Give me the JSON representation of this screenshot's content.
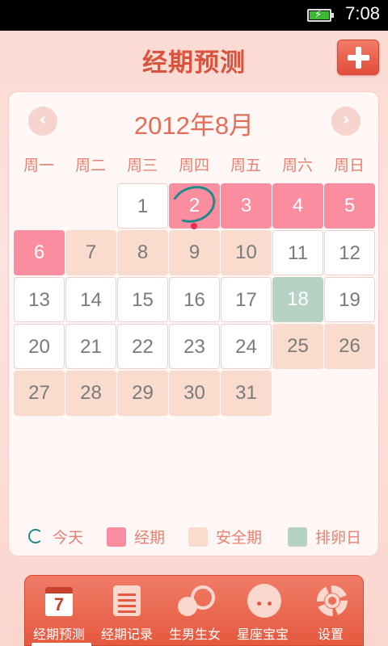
{
  "status_bar": {
    "time": "7:08",
    "battery_icon": "battery-charging-icon"
  },
  "header": {
    "title": "经期预测",
    "add_icon": "plus-icon"
  },
  "calendar": {
    "month_label": "2012年8月",
    "prev_icon": "chevron-left-icon",
    "next_icon": "chevron-right-icon",
    "weekdays": [
      "周一",
      "周二",
      "周三",
      "周四",
      "周五",
      "周六",
      "周日"
    ],
    "today": "2",
    "days": [
      {
        "label": "1",
        "type": "normal"
      },
      {
        "label": "2",
        "type": "period"
      },
      {
        "label": "3",
        "type": "period"
      },
      {
        "label": "4",
        "type": "period"
      },
      {
        "label": "5",
        "type": "period"
      },
      {
        "label": "6",
        "type": "period"
      },
      {
        "label": "7",
        "type": "safe"
      },
      {
        "label": "8",
        "type": "safe"
      },
      {
        "label": "9",
        "type": "safe"
      },
      {
        "label": "10",
        "type": "safe"
      },
      {
        "label": "11",
        "type": "normal"
      },
      {
        "label": "12",
        "type": "normal"
      },
      {
        "label": "13",
        "type": "normal"
      },
      {
        "label": "14",
        "type": "normal"
      },
      {
        "label": "15",
        "type": "normal"
      },
      {
        "label": "16",
        "type": "normal"
      },
      {
        "label": "17",
        "type": "normal"
      },
      {
        "label": "18",
        "type": "ovulation"
      },
      {
        "label": "19",
        "type": "normal"
      },
      {
        "label": "20",
        "type": "normal"
      },
      {
        "label": "21",
        "type": "normal"
      },
      {
        "label": "22",
        "type": "normal"
      },
      {
        "label": "23",
        "type": "normal"
      },
      {
        "label": "24",
        "type": "normal"
      },
      {
        "label": "25",
        "type": "safe"
      },
      {
        "label": "26",
        "type": "safe"
      },
      {
        "label": "27",
        "type": "safe"
      },
      {
        "label": "28",
        "type": "safe"
      },
      {
        "label": "29",
        "type": "safe"
      },
      {
        "label": "30",
        "type": "safe"
      },
      {
        "label": "31",
        "type": "safe"
      }
    ]
  },
  "legend": {
    "today": "今天",
    "period": "经期",
    "safe": "安全期",
    "ovulation": "排卵日"
  },
  "colors": {
    "period": "#fb8da0",
    "safe": "#f9dccd",
    "ovulation": "#b5d2c4",
    "accent": "#e5593f"
  },
  "bottom_nav": {
    "items": [
      {
        "label": "经期预测",
        "icon": "calendar-icon",
        "badge": "7",
        "selected": true
      },
      {
        "label": "经期记录",
        "icon": "notepad-icon"
      },
      {
        "label": "生男生女",
        "icon": "two-circles-icon"
      },
      {
        "label": "星座宝宝",
        "icon": "baby-face-icon"
      },
      {
        "label": "设置",
        "icon": "gear-icon"
      }
    ]
  }
}
